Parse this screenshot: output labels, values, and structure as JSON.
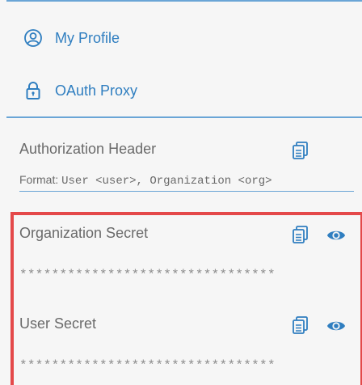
{
  "nav": {
    "items": [
      {
        "label": "My Profile",
        "icon": "profile-icon"
      },
      {
        "label": "OAuth Proxy",
        "icon": "lock-icon"
      }
    ]
  },
  "auth_header": {
    "label": "Authorization Header",
    "hint_prefix": "Format:",
    "hint_format": "User <user>, Organization <org>"
  },
  "secrets": {
    "org": {
      "label": "Organization Secret",
      "masked": "********************************"
    },
    "user": {
      "label": "User Secret",
      "masked": "********************************"
    }
  },
  "colors": {
    "accent": "#2f7ec0",
    "highlight_border": "#e4494a"
  }
}
